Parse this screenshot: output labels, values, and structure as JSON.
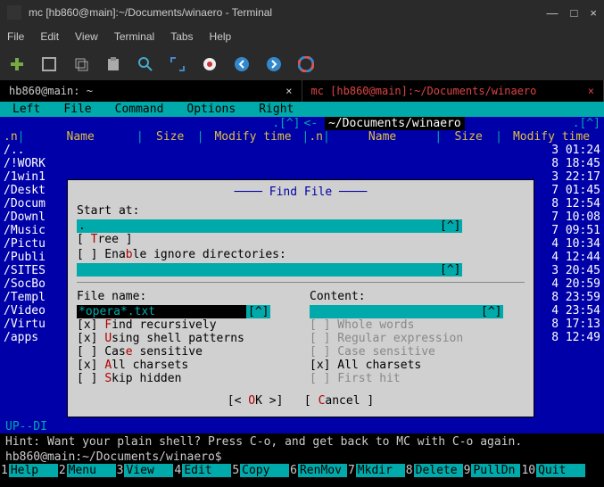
{
  "window": {
    "title": "mc [hb860@main]:~/Documents/winaero - Terminal",
    "minimize": "—",
    "maximize": "□",
    "close": "×"
  },
  "menubar": {
    "file": "File",
    "edit": "Edit",
    "view": "View",
    "terminal": "Terminal",
    "tabs": "Tabs",
    "help": "Help"
  },
  "terminal_tabs": {
    "tab1": {
      "label": "hb860@main: ~",
      "close": "×"
    },
    "tab2": {
      "label": "mc [hb860@main]:~/Documents/winaero",
      "close": "×"
    }
  },
  "mc_menu": {
    "left": "Left",
    "file": "File",
    "command": "Command",
    "options": "Options",
    "right": "Right"
  },
  "panel": {
    "left_corner": ".[^]",
    "right_path": "~/Documents/winaero",
    "right_corner": ".[^]",
    "col_n1": ".n",
    "col_name": "Name",
    "col_size": "Size",
    "col_time": "Modify time",
    "col_n2": ".n"
  },
  "left_dirs": [
    "/..",
    "/!WORK",
    "/1win1",
    "/Deskt",
    "/Docum",
    "/Downl",
    "/Music",
    "/Pictu",
    "/Publi",
    "/SITES",
    "/SocBo",
    "/Templ",
    "/Video",
    "/Virtu",
    "/apps"
  ],
  "right_times": [
    "3 01:24",
    "8 18:45",
    "3 22:17",
    "7 01:45",
    "8 12:54",
    "7 10:08",
    "7 09:51",
    "4 10:34",
    "4 12:44",
    "3 20:45",
    "4 20:59",
    "8 23:59",
    "4 23:54",
    "8 17:13",
    "8 12:49"
  ],
  "dialog": {
    "title": "Find File",
    "start_at_label": "Start at:",
    "start_at_value": ".",
    "caret": "[^]",
    "tree": "[ Tree ]",
    "ignore_label": "[ ] Enable ignore directories:",
    "file_name_label": "File name:",
    "file_name_value": "*opera*.txt",
    "content_label": "Content:",
    "find_recursively": "[x] Find recursively",
    "using_shell": "[x] Using shell patterns",
    "case_sensitive_l": "[ ] Case sensitive",
    "all_charsets_l": "[x] All charsets",
    "skip_hidden": "[ ] Skip hidden",
    "whole_words": "[ ] Whole words",
    "regex": "[ ] Regular expression",
    "case_sensitive_r": "[ ] Case sensitive",
    "all_charsets_r": "[x] All charsets",
    "first_hit": "[ ] First hit",
    "ok": "[< OK >]",
    "cancel": "[ Cancel ]"
  },
  "status": "UP--DI",
  "hint": "Hint: Want your plain shell? Press C-o, and get back to MC with C-o again.",
  "prompt": "hb860@main:~/Documents/winaero$",
  "fkeys": [
    {
      "n": "1",
      "l": "Help"
    },
    {
      "n": "2",
      "l": "Menu"
    },
    {
      "n": "3",
      "l": "View"
    },
    {
      "n": "4",
      "l": "Edit"
    },
    {
      "n": "5",
      "l": "Copy"
    },
    {
      "n": "6",
      "l": "RenMov"
    },
    {
      "n": "7",
      "l": "Mkdir"
    },
    {
      "n": "8",
      "l": "Delete"
    },
    {
      "n": "9",
      "l": "PullDn"
    },
    {
      "n": "10",
      "l": "Quit"
    }
  ]
}
